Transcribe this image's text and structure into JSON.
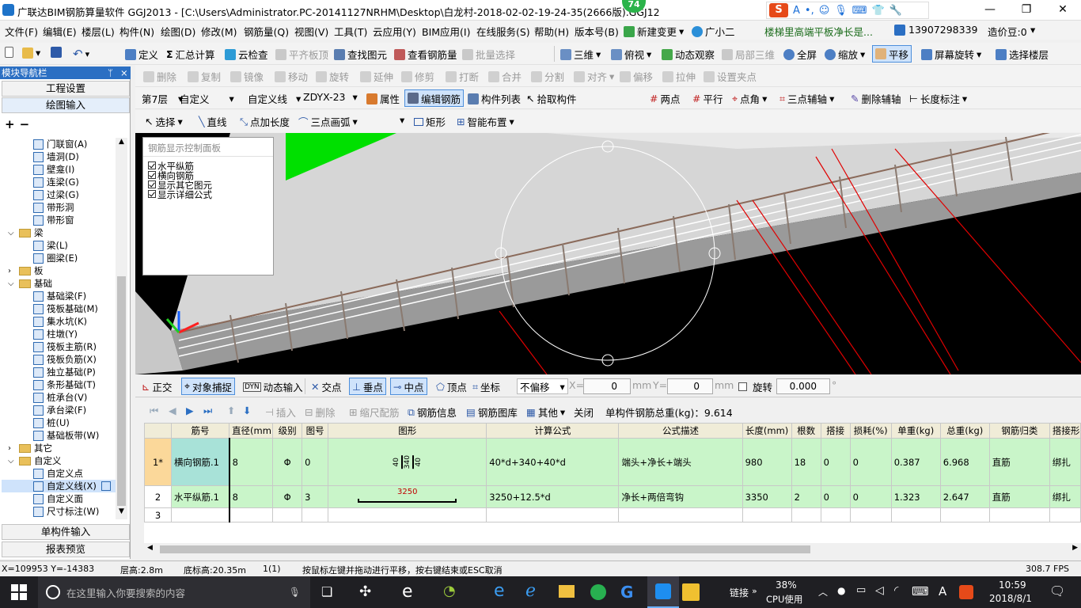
{
  "window": {
    "title": "广联达BIM钢筋算量软件 GGJ2013 - [C:\\Users\\Administrator.PC-20141127NRHM\\Desktop\\白龙村-2018-02-02-19-24-35(2666版).GGJ12",
    "badge": "74",
    "controls": [
      "—",
      "❐",
      "✕"
    ]
  },
  "menu": {
    "items": [
      "文件(F)",
      "编辑(E)",
      "楼层(L)",
      "构件(N)",
      "绘图(D)",
      "修改(M)",
      "钢筋量(Q)",
      "视图(V)",
      "工具(T)",
      "云应用(Y)",
      "BIM应用(I)",
      "在线服务(S)",
      "帮助(H)",
      "版本号(B)"
    ],
    "new_change": "新建变更",
    "guangxiao": "广小二",
    "notice": "楼梯里高端平板净长是...",
    "phone": "13907298339",
    "zaojiadou": "造价豆:0"
  },
  "toolbar1": {
    "items": [
      "定义",
      "汇总计算",
      "云检查",
      "平齐板顶",
      "查找图元",
      "查看钢筋量",
      "批量选择",
      "三维",
      "俯视",
      "动态观察",
      "局部三维",
      "全屏",
      "缩放",
      "平移",
      "屏幕旋转",
      "选择楼层"
    ]
  },
  "toolbar2": {
    "items": [
      "删除",
      "复制",
      "镜像",
      "移动",
      "旋转",
      "延伸",
      "修剪",
      "打断",
      "合并",
      "分割",
      "对齐",
      "偏移",
      "拉伸",
      "设置夹点"
    ]
  },
  "toolbar3": {
    "floor": "第7层",
    "type": "自定义",
    "subtype": "自定义线",
    "element": "ZDYX-23",
    "items": [
      "属性",
      "编辑钢筋",
      "构件列表",
      "拾取构件",
      "两点",
      "平行",
      "点角",
      "三点辅轴",
      "删除辅轴",
      "长度标注"
    ]
  },
  "toolbar4": {
    "items": [
      "选择",
      "直线",
      "点加长度",
      "三点画弧",
      "矩形",
      "智能布置"
    ]
  },
  "nav": {
    "header": "模块导航栏",
    "header_pin": "ᛘ",
    "header_close": "×",
    "btn_project": "工程设置",
    "btn_draw": "绘图输入",
    "tree": [
      {
        "label": "门联窗(A)",
        "level": 2
      },
      {
        "label": "墙洞(D)",
        "level": 2
      },
      {
        "label": "壁龛(I)",
        "level": 2
      },
      {
        "label": "连梁(G)",
        "level": 2
      },
      {
        "label": "过梁(G)",
        "level": 2
      },
      {
        "label": "带形洞",
        "level": 2
      },
      {
        "label": "带形窗",
        "level": 2
      },
      {
        "label": "梁",
        "level": 1,
        "folder": true,
        "open": true
      },
      {
        "label": "梁(L)",
        "level": 2
      },
      {
        "label": "圈梁(E)",
        "level": 2
      },
      {
        "label": "板",
        "level": 1,
        "folder": true,
        "open": false
      },
      {
        "label": "基础",
        "level": 1,
        "folder": true,
        "open": true
      },
      {
        "label": "基础梁(F)",
        "level": 2
      },
      {
        "label": "筏板基础(M)",
        "level": 2
      },
      {
        "label": "集水坑(K)",
        "level": 2
      },
      {
        "label": "柱墩(Y)",
        "level": 2
      },
      {
        "label": "筏板主筋(R)",
        "level": 2
      },
      {
        "label": "筏板负筋(X)",
        "level": 2
      },
      {
        "label": "独立基础(P)",
        "level": 2
      },
      {
        "label": "条形基础(T)",
        "level": 2
      },
      {
        "label": "桩承台(V)",
        "level": 2
      },
      {
        "label": "承台梁(F)",
        "level": 2
      },
      {
        "label": "桩(U)",
        "level": 2
      },
      {
        "label": "基础板带(W)",
        "level": 2
      },
      {
        "label": "其它",
        "level": 1,
        "folder": true,
        "open": false
      },
      {
        "label": "自定义",
        "level": 1,
        "folder": true,
        "open": true
      },
      {
        "label": "自定义点",
        "level": 2
      },
      {
        "label": "自定义线(X)",
        "level": 2,
        "selected": true
      },
      {
        "label": "自定义面",
        "level": 2
      },
      {
        "label": "尺寸标注(W)",
        "level": 2
      }
    ],
    "btn_single": "单构件输入",
    "btn_report": "报表预览"
  },
  "rebar_panel": {
    "title": "钢筋显示控制面板",
    "options": [
      "水平纵筋",
      "横向钢筋",
      "显示其它图元",
      "显示详细公式"
    ]
  },
  "snapbar": {
    "items": [
      "正交",
      "对象捕捉",
      "动态输入",
      "交点",
      "垂点",
      "中点",
      "顶点",
      "坐标"
    ],
    "offset_mode": "不偏移",
    "x_label": "X=",
    "x_value": "0",
    "y_label": "Y=",
    "y_value": "0",
    "unit": "mm",
    "rotate_label": "旋转",
    "rotate_value": "0.000",
    "degree": "°"
  },
  "gridbar": {
    "items": [
      "插入",
      "删除",
      "缩尺配筋",
      "钢筋信息",
      "钢筋图库",
      "其他",
      "关闭"
    ],
    "total_label": "单构件钢筋总重(kg)：9.614"
  },
  "table": {
    "headers": [
      "筋号",
      "直径(mm)",
      "级别",
      "图号",
      "图形",
      "计算公式",
      "公式描述",
      "长度(mm)",
      "根数",
      "搭接",
      "损耗(%)",
      "单重(kg)",
      "总重(kg)",
      "钢筋归类",
      "搭接形"
    ],
    "rows": [
      {
        "num": "1*",
        "name": "横向钢筋.1",
        "dia": "8",
        "grade": "Φ",
        "fig": "0",
        "shape": [
          "40",
          "340",
          "40"
        ],
        "formula": "40*d+340+40*d",
        "desc": "端头+净长+端头",
        "len": "980",
        "count": "18",
        "lap": "0",
        "loss": "0",
        "unit_w": "0.387",
        "total_w": "6.968",
        "cat": "直筋",
        "lap_type": "绑扎"
      },
      {
        "num": "2",
        "name": "水平纵筋.1",
        "dia": "8",
        "grade": "Φ",
        "fig": "3",
        "shape": [
          "3250"
        ],
        "formula": "3250+12.5*d",
        "desc": "净长+两倍弯钩",
        "len": "3350",
        "count": "2",
        "lap": "0",
        "loss": "0",
        "unit_w": "1.323",
        "total_w": "2.647",
        "cat": "直筋",
        "lap_type": "绑扎"
      },
      {
        "num": "3"
      }
    ]
  },
  "status": {
    "coords": "X=109953 Y=-14383",
    "floor_height": "层高:2.8m",
    "bottom_height": "底标高:20.35m",
    "count": "1(1)",
    "hint": "按鼠标左键并拖动进行平移，按右键结束或ESC取消",
    "fps": "308.7 FPS"
  },
  "taskbar": {
    "search_placeholder": "在这里输入你要搜索的内容",
    "link_label": "链接",
    "cpu_percent": "38%",
    "cpu_label": "CPU使用",
    "ime": "A",
    "time": "10:59",
    "date": "2018/8/1"
  },
  "colors": {
    "accent": "#2b6fc3",
    "row_green": "#c9f5c9",
    "header_yellow": "#f0ecd8",
    "beam_green": "#00e000",
    "red_line": "#e00000"
  }
}
